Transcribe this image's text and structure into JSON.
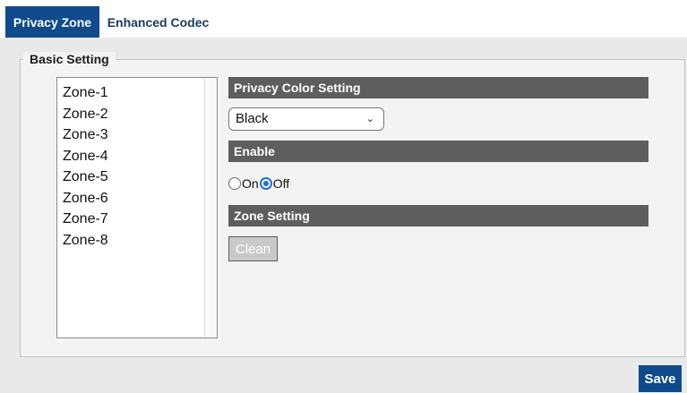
{
  "tabs": [
    {
      "label": "Privacy Zone",
      "active": true
    },
    {
      "label": "Enhanced Codec",
      "active": false
    }
  ],
  "basic_setting": {
    "legend": "Basic Setting",
    "zones": [
      "Zone-1",
      "Zone-2",
      "Zone-3",
      "Zone-4",
      "Zone-5",
      "Zone-6",
      "Zone-7",
      "Zone-8"
    ]
  },
  "privacy_color": {
    "header": "Privacy Color Setting",
    "selected": "Black"
  },
  "enable": {
    "header": "Enable",
    "on_label": "On",
    "off_label": "Off",
    "selected": "Off"
  },
  "zone_setting": {
    "header": "Zone Setting",
    "clean_label": "Clean"
  },
  "actions": {
    "save_label": "Save"
  },
  "colors": {
    "accent": "#0e4a8c",
    "section_header": "#5e5e5e",
    "radio_checked": "#1e6fe0"
  },
  "icons": {
    "select_arrow": "chevron-down-icon"
  }
}
